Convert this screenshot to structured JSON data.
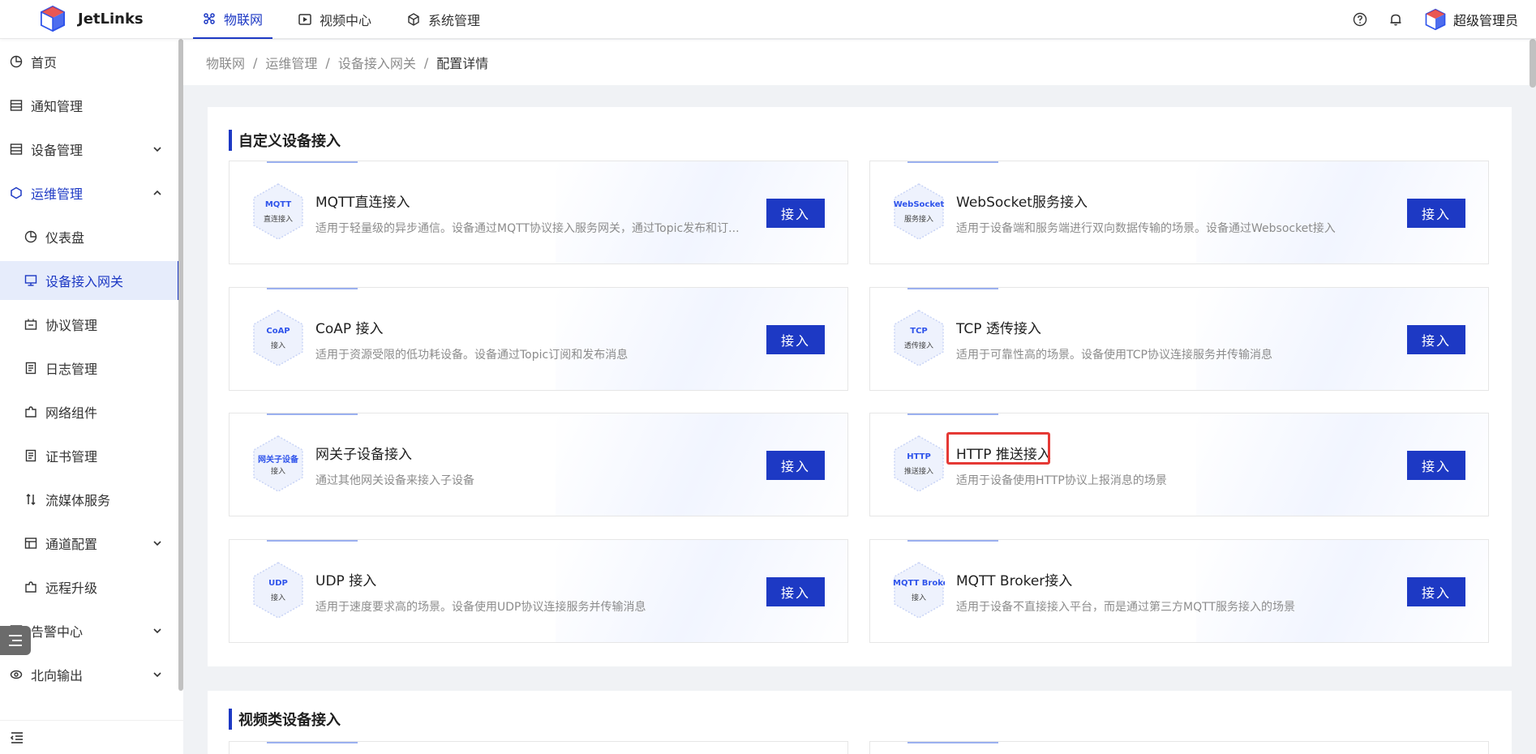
{
  "app": {
    "logo_text": "JetLinks"
  },
  "topnav": [
    {
      "label": "物联网",
      "icon": "iot-icon",
      "active": true
    },
    {
      "label": "视频中心",
      "icon": "play-icon",
      "active": false
    },
    {
      "label": "系统管理",
      "icon": "cube-icon",
      "active": false
    }
  ],
  "header": {
    "user_name": "超级管理员"
  },
  "sidebar": {
    "items": [
      {
        "label": "首页",
        "icon": "pie-chart-icon"
      },
      {
        "label": "通知管理",
        "icon": "list-icon"
      },
      {
        "label": "设备管理",
        "icon": "list-icon",
        "chevron": "down"
      },
      {
        "label": "运维管理",
        "icon": "ops-icon",
        "chevron": "up"
      },
      {
        "label": "仪表盘",
        "icon": "dashboard-icon"
      },
      {
        "label": "设备接入网关",
        "icon": "monitor-icon"
      },
      {
        "label": "协议管理",
        "icon": "protocol-icon"
      },
      {
        "label": "日志管理",
        "icon": "log-icon"
      },
      {
        "label": "网络组件",
        "icon": "puzzle-icon"
      },
      {
        "label": "证书管理",
        "icon": "certificate-icon"
      },
      {
        "label": "流媒体服务",
        "icon": "stream-icon"
      },
      {
        "label": "通道配置",
        "icon": "channel-icon",
        "chevron": "down"
      },
      {
        "label": "远程升级",
        "icon": "puzzle-icon"
      },
      {
        "label": "告警中心",
        "icon": "alarm-icon",
        "chevron": "down"
      },
      {
        "label": "北向输出",
        "icon": "output-icon",
        "chevron": "down"
      }
    ]
  },
  "breadcrumb": [
    "物联网",
    "运维管理",
    "设备接入网关",
    "配置详情"
  ],
  "sections": [
    {
      "title": "自定义设备接入",
      "cards": [
        {
          "hex_title": "MQTT",
          "hex_sub": "直连接入",
          "title": "MQTT直连接入",
          "desc": "适用于轻量级的异步通信。设备通过MQTT协议接入服务网关，通过Topic发布和订...",
          "button": "接入"
        },
        {
          "hex_title": "WebSocket",
          "hex_sub": "服务接入",
          "title": "WebSocket服务接入",
          "desc": "适用于设备端和服务端进行双向数据传输的场景。设备通过Websocket接入",
          "button": "接入"
        },
        {
          "hex_title": "CoAP",
          "hex_sub": "接入",
          "title": "CoAP 接入",
          "desc": "适用于资源受限的低功耗设备。设备通过Topic订阅和发布消息",
          "button": "接入"
        },
        {
          "hex_title": "TCP",
          "hex_sub": "透传接入",
          "title": "TCP 透传接入",
          "desc": "适用于可靠性高的场景。设备使用TCP协议连接服务并传输消息",
          "button": "接入"
        },
        {
          "hex_title": "网关子设备",
          "hex_sub": "接入",
          "title": "网关子设备接入",
          "desc": "通过其他网关设备来接入子设备",
          "button": "接入"
        },
        {
          "hex_title": "HTTP",
          "hex_sub": "推送接入",
          "title": "HTTP 推送接入",
          "desc": "适用于设备使用HTTP协议上报消息的场景",
          "button": "接入",
          "highlighted": true
        },
        {
          "hex_title": "UDP",
          "hex_sub": "接入",
          "title": "UDP 接入",
          "desc": "适用于速度要求高的场景。设备使用UDP协议连接服务并传输消息",
          "button": "接入"
        },
        {
          "hex_title": "MQTT Broke",
          "hex_sub": "接入",
          "title": "MQTT Broker接入",
          "desc": "适用于设备不直接接入平台，而是通过第三方MQTT服务接入的场景",
          "button": "接入"
        }
      ]
    },
    {
      "title": "视频类设备接入",
      "cards": []
    }
  ],
  "colors": {
    "primary": "#1d39c4",
    "highlight": "#e53935"
  }
}
